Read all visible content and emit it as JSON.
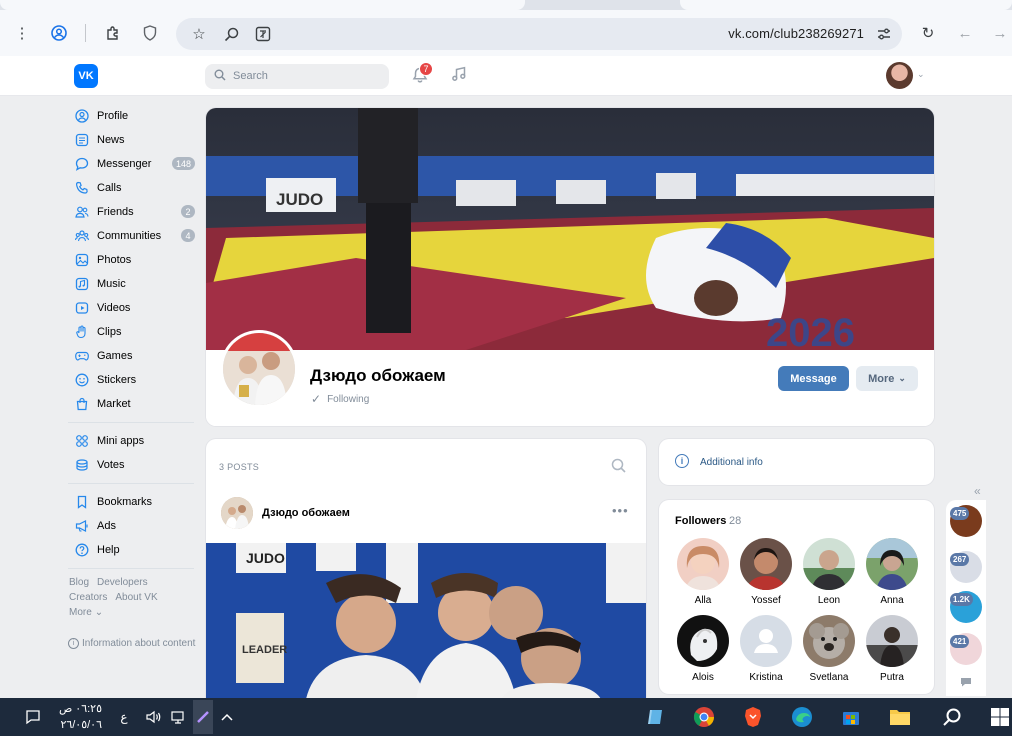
{
  "browser": {
    "url": "vk.com/club238269271"
  },
  "header": {
    "logo": "VK",
    "search_placeholder": "Search",
    "notifications_count": "7"
  },
  "menu": {
    "items": [
      {
        "label": "Profile",
        "icon": "user-circle-icon",
        "badge": ""
      },
      {
        "label": "News",
        "icon": "news-icon",
        "badge": ""
      },
      {
        "label": "Messenger",
        "icon": "chat-icon",
        "badge": "148"
      },
      {
        "label": "Calls",
        "icon": "phone-icon",
        "badge": ""
      },
      {
        "label": "Friends",
        "icon": "friends-icon",
        "badge": "2"
      },
      {
        "label": "Communities",
        "icon": "communities-icon",
        "badge": "4"
      },
      {
        "label": "Photos",
        "icon": "photo-icon",
        "badge": ""
      },
      {
        "label": "Music",
        "icon": "music-icon",
        "badge": ""
      },
      {
        "label": "Videos",
        "icon": "video-icon",
        "badge": ""
      },
      {
        "label": "Clips",
        "icon": "clips-icon",
        "badge": ""
      },
      {
        "label": "Games",
        "icon": "gamepad-icon",
        "badge": ""
      },
      {
        "label": "Stickers",
        "icon": "smile-icon",
        "badge": ""
      },
      {
        "label": "Market",
        "icon": "bag-icon",
        "badge": ""
      }
    ],
    "items2": [
      {
        "label": "Mini apps",
        "icon": "grid-icon"
      },
      {
        "label": "Votes",
        "icon": "coins-icon"
      }
    ],
    "items3": [
      {
        "label": "Bookmarks",
        "icon": "bookmark-icon"
      },
      {
        "label": "Ads",
        "icon": "megaphone-icon"
      },
      {
        "label": "Help",
        "icon": "help-icon"
      }
    ],
    "footer": {
      "blog": "Blog",
      "developers": "Developers",
      "creators": "Creators",
      "about": "About VK",
      "more": "More",
      "info_content": "Information about content"
    }
  },
  "group": {
    "name": "Дзюдо обожаем",
    "following": "Following",
    "message_button": "Message",
    "more_button": "More"
  },
  "posts": {
    "count_label": "3 POSTS",
    "author": "Дзюдо обожаем"
  },
  "additional_info": "Additional info",
  "followers": {
    "title": "Followers",
    "count": "28",
    "list": [
      {
        "name": "Alla"
      },
      {
        "name": "Yossef"
      },
      {
        "name": "Leon"
      },
      {
        "name": "Anna"
      },
      {
        "name": "Alois"
      },
      {
        "name": "Kristina"
      },
      {
        "name": "Svetlana"
      },
      {
        "name": "Putra"
      }
    ]
  },
  "chats": {
    "badges": [
      "475",
      "267",
      "1.2K",
      "421"
    ]
  },
  "taskbar": {
    "time": "٠٦:٢٥ ص",
    "date": "٢٦/٠٥/٠٦",
    "lang": "ع"
  }
}
